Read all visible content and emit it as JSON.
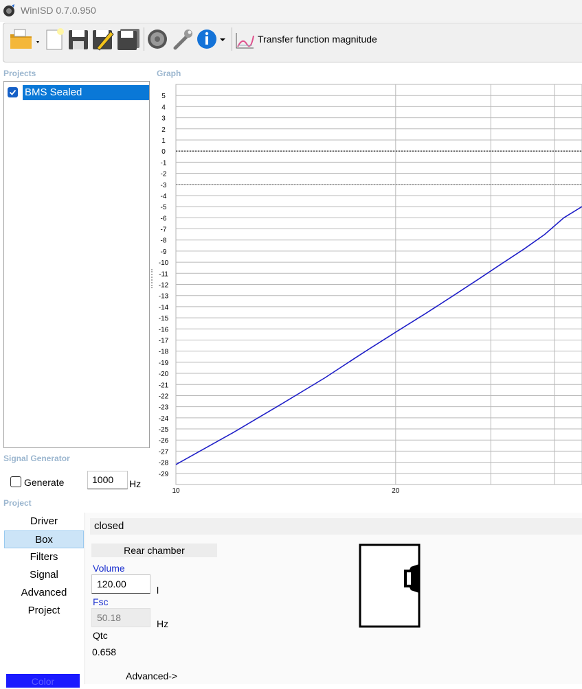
{
  "window": {
    "title": "WinISD 0.7.0.950"
  },
  "toolbar": {
    "icons": [
      "open-folder-icon",
      "new-project-icon",
      "save-icon",
      "save-as-icon",
      "save-all-icon",
      "driver-icon",
      "tools-icon",
      "info-icon"
    ],
    "graph_select_label": "Transfer function magnitude"
  },
  "projects": {
    "section_label": "Projects",
    "items": [
      {
        "name": "BMS Sealed",
        "checked": true
      }
    ]
  },
  "graph": {
    "section_label": "Graph"
  },
  "chart_data": {
    "type": "line",
    "title": "",
    "xlabel": "",
    "ylabel": "",
    "x_scale": "log",
    "xlim": [
      10,
      36
    ],
    "ylim": [
      -30,
      6
    ],
    "y_ticks": [
      5,
      4,
      3,
      2,
      1,
      0,
      -1,
      -2,
      -3,
      -4,
      -5,
      -6,
      -7,
      -8,
      -9,
      -10,
      -11,
      -12,
      -13,
      -14,
      -15,
      -16,
      -17,
      -18,
      -19,
      -20,
      -21,
      -22,
      -23,
      -24,
      -25,
      -26,
      -27,
      -28,
      -29
    ],
    "x_tick_labels": [
      {
        "value": 10,
        "label": "10"
      },
      {
        "value": 20,
        "label": "20"
      }
    ],
    "x_gridlines": [
      20,
      27,
      33
    ],
    "reference_lines": [
      {
        "y": 0,
        "style": "dotted"
      },
      {
        "y": -3,
        "style": "dotted"
      }
    ],
    "grid": true,
    "series": [
      {
        "color": "#2020c8",
        "x": [
          10,
          12,
          14,
          16,
          18,
          20,
          22,
          24,
          26,
          28,
          30,
          32,
          34,
          36
        ],
        "y": [
          -28.2,
          -25.3,
          -22.7,
          -20.4,
          -18.2,
          -16.3,
          -14.6,
          -13.0,
          -11.5,
          -10.1,
          -8.8,
          -7.5,
          -6.0,
          -5.0
        ]
      }
    ]
  },
  "signal_generator": {
    "section_label": "Signal Generator",
    "generate_label": "Generate",
    "generate_checked": false,
    "frequency": "1000",
    "unit": "Hz"
  },
  "project_section": {
    "section_label": "Project",
    "nav": [
      "Driver",
      "Box",
      "Filters",
      "Signal",
      "Advanced",
      "Project"
    ],
    "selected": "Box",
    "color_button": "Color"
  },
  "box": {
    "type": "closed",
    "rear_chamber_label": "Rear chamber",
    "volume_label": "Volume",
    "volume_value": "120.00",
    "volume_unit": "l",
    "fsc_label": "Fsc",
    "fsc_value": "50.18",
    "fsc_unit": "Hz",
    "qtc_label": "Qtc",
    "qtc_value": "0.658",
    "advanced_label": "Advanced->"
  }
}
